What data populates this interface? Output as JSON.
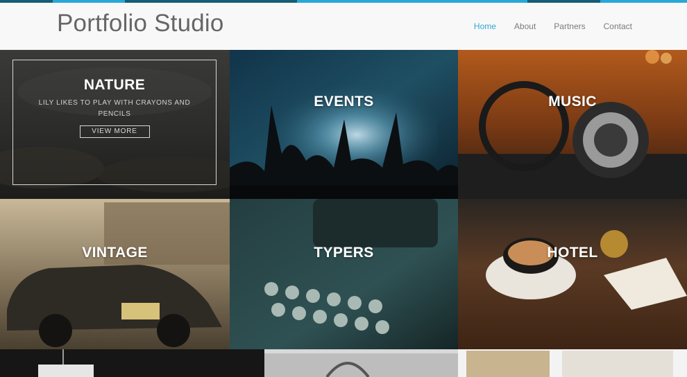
{
  "site": {
    "brand": "Portfolio Studio"
  },
  "nav": {
    "items": [
      "Home",
      "About",
      "Partners",
      "Contact"
    ],
    "active": "Home"
  },
  "colors": {
    "accent": "#2fa8d2",
    "strip_dark": "#155e75",
    "strip_light": "#27a8d8"
  },
  "featured": {
    "title": "NATURE",
    "description": "LILY LIKES TO PLAY WITH CRAYONS AND PENCILS",
    "button": "VIEW MORE"
  },
  "tiles": [
    "EVENTS",
    "MUSIC",
    "VINTAGE",
    "TYPERS",
    "HOTEL"
  ]
}
